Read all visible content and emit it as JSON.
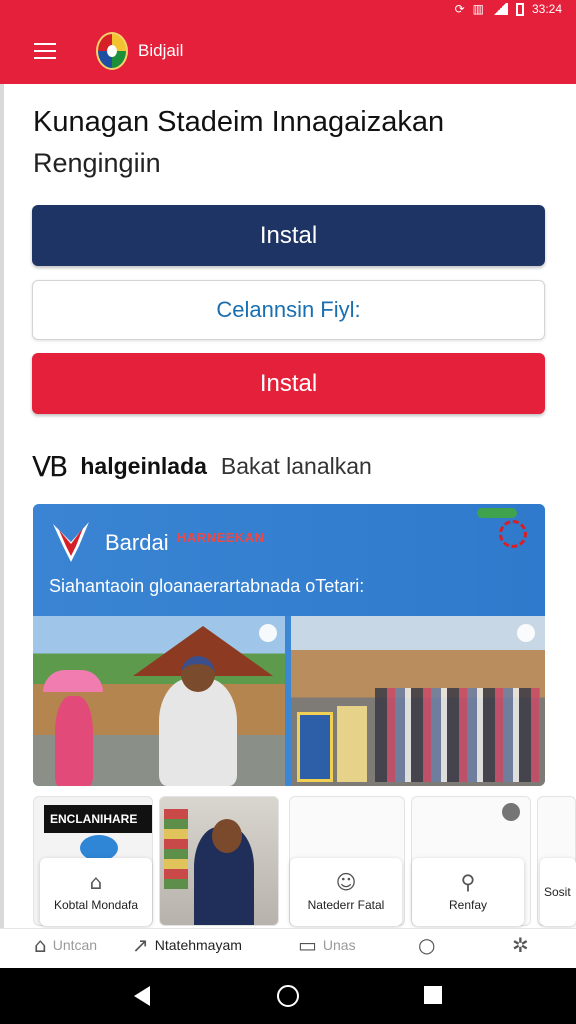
{
  "status_bar": {
    "time": "33:24",
    "icons": [
      "sync-icon",
      "nfc-icon",
      "signal-icon",
      "battery-icon"
    ]
  },
  "app_bar": {
    "title": "Bidjail",
    "menu_icon": "hamburger-icon",
    "logo": "app-logo"
  },
  "headline": "Kunagan Stadeim Innagaizakan",
  "subheadline": "Rengingiin",
  "buttons": {
    "primary_label": "Instal",
    "outline_label": "Celannsin Fiyl:",
    "danger_label": "Instal"
  },
  "section": {
    "icon_text": "VB",
    "title_bold": "halgeinlada",
    "title_light": "Bakat lanalkan"
  },
  "banner": {
    "brand": "Bardai",
    "tag": "HARNEEKAN",
    "subtitle": "Siahantaoin gloanaerartabnada oTetari:"
  },
  "thumbnails": {
    "strip_text": "ENCLANIHARE"
  },
  "cards": [
    {
      "label": "Kobtal Mondafa",
      "icon": "building-icon"
    },
    {
      "label": "Natederr Fatal",
      "icon": "chat-person-icon"
    },
    {
      "label": "Renfay",
      "icon": "person-pin-icon"
    },
    {
      "label": "Sosit",
      "icon": "more-icon"
    }
  ],
  "bottom_nav": [
    {
      "label": "Untcan",
      "icon": "home-icon"
    },
    {
      "label": "Ntatehmayam",
      "icon": "share-icon"
    },
    {
      "label": "Unas",
      "icon": "tablet-icon"
    },
    {
      "label": "",
      "icon": "circle-icon"
    },
    {
      "label": "",
      "icon": "bug-icon"
    }
  ],
  "colors": {
    "brand_red": "#e4203a",
    "navy": "#1e3465",
    "link_blue": "#1a6fb0",
    "banner_blue": "#3b86d5"
  }
}
